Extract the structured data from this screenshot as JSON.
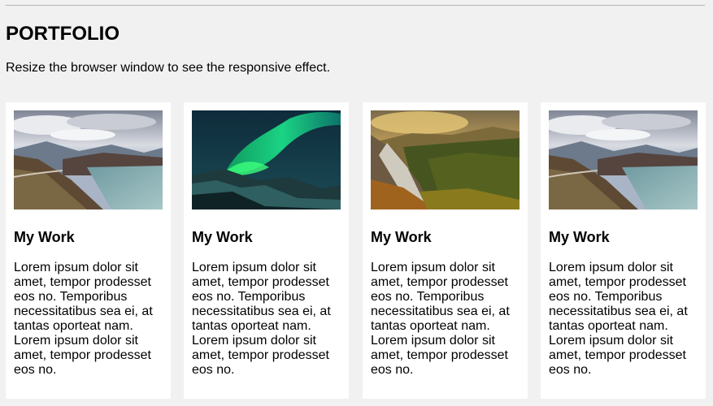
{
  "page": {
    "title": "PORTFOLIO",
    "subtitle": "Resize the browser window to see the responsive effect."
  },
  "cards": [
    {
      "title": "My Work",
      "text": "Lorem ipsum dolor sit amet, tempor prodesset eos no. Temporibus necessitatibus sea ei, at tantas oporteat nam. Lorem ipsum dolor sit amet, tempor prodesset eos no.",
      "image_icon": "mountain-lake-photo"
    },
    {
      "title": "My Work",
      "text": "Lorem ipsum dolor sit amet, tempor prodesset eos no. Temporibus necessitatibus sea ei, at tantas oporteat nam. Lorem ipsum dolor sit amet, tempor prodesset eos no.",
      "image_icon": "northern-lights-photo"
    },
    {
      "title": "My Work",
      "text": "Lorem ipsum dolor sit amet, tempor prodesset eos no. Temporibus necessitatibus sea ei, at tantas oporteat nam. Lorem ipsum dolor sit amet, tempor prodesset eos no.",
      "image_icon": "forest-valley-photo"
    },
    {
      "title": "My Work",
      "text": "Lorem ipsum dolor sit amet, tempor prodesset eos no. Temporibus necessitatibus sea ei, at tantas oporteat nam. Lorem ipsum dolor sit amet, tempor prodesset eos no.",
      "image_icon": "mountain-lake-photo"
    }
  ],
  "colors": {
    "page_background": "#f1f1f1",
    "card_background": "#ffffff",
    "rule": "#b3b3b3"
  }
}
